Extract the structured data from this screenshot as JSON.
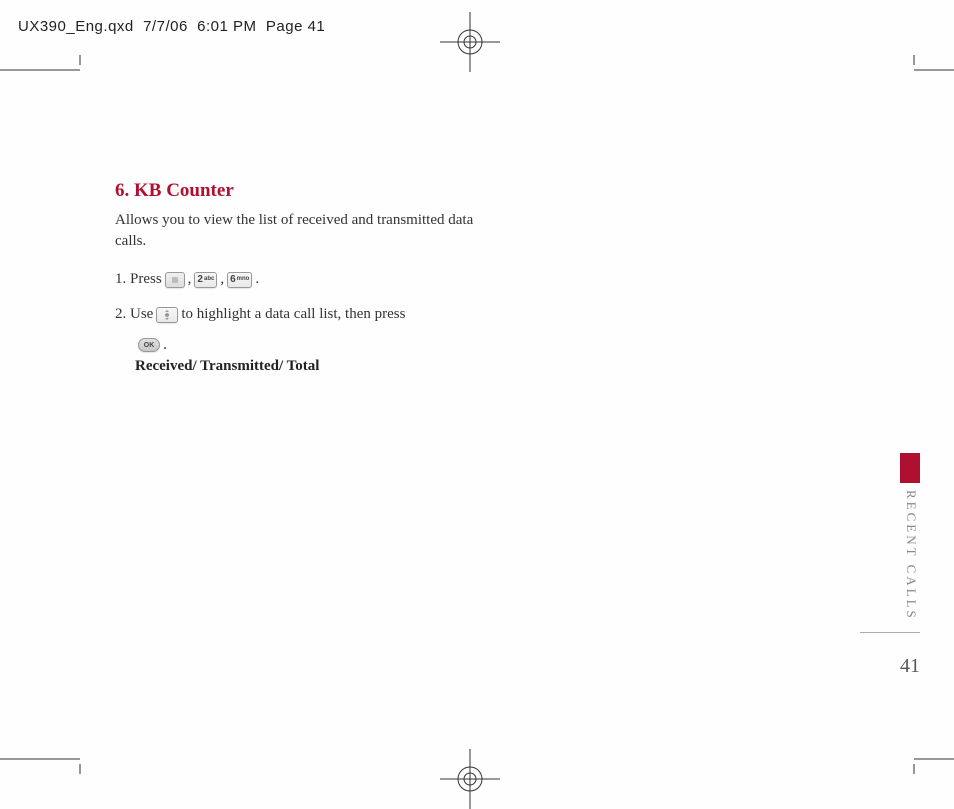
{
  "header": {
    "filename": "UX390_Eng.qxd",
    "date": "7/7/06",
    "time": "6:01 PM",
    "page_info": "Page 41"
  },
  "content": {
    "title": "6. KB Counter",
    "description": "Allows you to view the list of received and transmitted data calls.",
    "step1_prefix": "1. Press ",
    "step1_sep": ", ",
    "step1_end": " .",
    "step2_prefix": "2. Use ",
    "step2_mid": " to highlight a data call list, then press",
    "step2_end": " .",
    "options": "Received/ Transmitted/ Total",
    "keys": {
      "key2_num": "2",
      "key2_label": "abc",
      "key6_num": "6",
      "key6_label": "mno",
      "ok_label": "OK"
    }
  },
  "side": {
    "section_label": "RECENT CALLS",
    "page_number": "41"
  }
}
